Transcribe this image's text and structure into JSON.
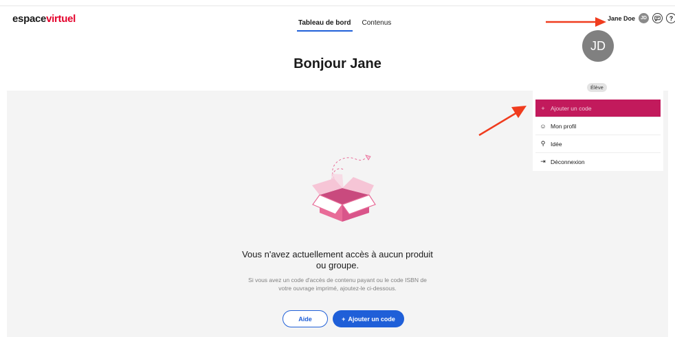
{
  "header": {
    "logo_part1": "espace",
    "logo_part2": "virtuel",
    "tabs": [
      {
        "label": "Tableau de bord",
        "active": true
      },
      {
        "label": "Contenus",
        "active": false
      }
    ],
    "user_name": "Jane Doe",
    "user_initials": "JD",
    "help_glyph": "?"
  },
  "page": {
    "greeting": "Bonjour Jane"
  },
  "empty_state": {
    "title_line1": "Vous n'avez actuellement accès à aucun produit",
    "title_line2": "ou groupe.",
    "desc_line1": "Si vous avez un code d'accès de contenu payant ou le code ISBN de",
    "desc_line2": "votre ouvrage imprimé, ajoutez-le ci-dessous.",
    "help_button": "Aide",
    "add_button_icon": "+",
    "add_button": "Ajouter un code"
  },
  "user_menu": {
    "initials": "JD",
    "role": "Élève",
    "items": [
      {
        "icon": "+",
        "label": "Ajouter un code"
      },
      {
        "icon": "☺",
        "label": "Mon profil"
      },
      {
        "icon": "⚲",
        "label": "Idée"
      },
      {
        "icon": "⇥",
        "label": "Déconnexion"
      }
    ]
  },
  "colors": {
    "brand_red": "#e4002b",
    "primary_blue": "#1f5fd8",
    "menu_highlight": "#c21a5c",
    "annotation_arrow": "#f03c1e",
    "illustration_pink": "#e86c98"
  },
  "icons": [
    "user-avatar-icon",
    "chat-icon",
    "help-icon",
    "plus-icon",
    "profile-icon",
    "location-pin-icon",
    "logout-icon",
    "empty-box-illustration"
  ]
}
